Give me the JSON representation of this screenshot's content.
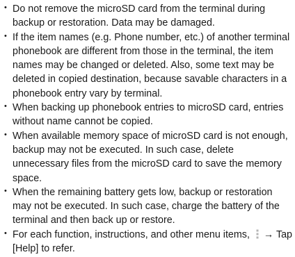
{
  "notes": [
    "Do not remove the microSD card from the terminal during backup or restoration. Data may be damaged.",
    "If the item names (e.g. Phone number, etc.) of another terminal phonebook are different from those in the terminal, the item names may be changed or deleted. Also, some text may be deleted in copied destination, because savable characters in a phonebook entry vary by terminal.",
    "When backing up phonebook entries to microSD card, entries without name cannot be copied.",
    "When available memory space of microSD card is not enough, backup may not be executed. In such case, delete unnecessary files from the microSD card to save the memory space.",
    "When the remaining battery gets low, backup or restoration may not be executed. In such case, charge the battery of the terminal and then back up or restore."
  ],
  "last_note": {
    "before_icon": "For each function, instructions, and other menu items,",
    "arrow": "→",
    "after_icon": "Tap [Help] to refer."
  },
  "icons": {
    "menu": "vertical-dots-menu-icon"
  },
  "bullet_glyph": "•"
}
